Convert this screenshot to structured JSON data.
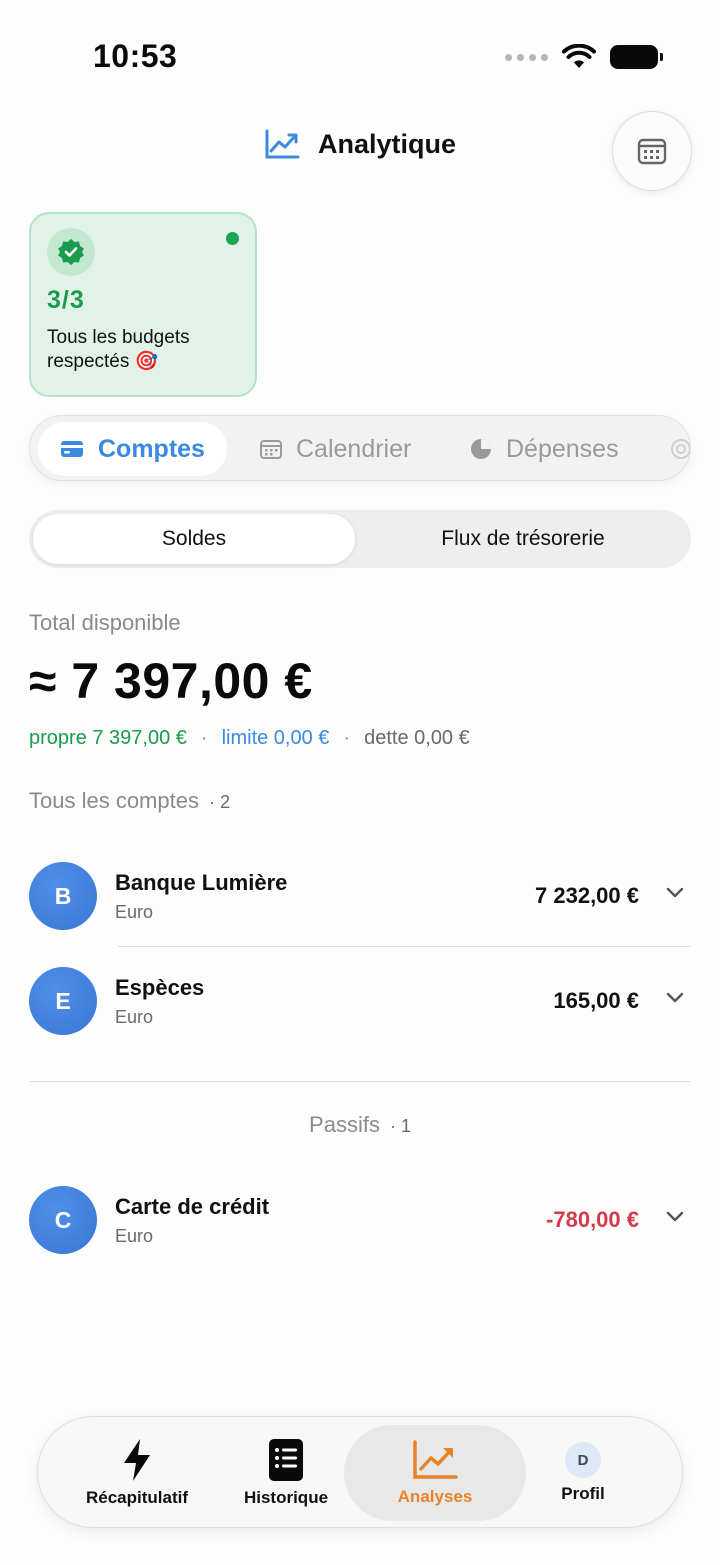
{
  "status_bar": {
    "time": "10:53"
  },
  "header": {
    "title": "Analytique"
  },
  "budget_card": {
    "count": "3/3",
    "text": "Tous les budgets respectés 🎯"
  },
  "tabs": [
    {
      "label": "Comptes",
      "active": true
    },
    {
      "label": "Calendrier",
      "active": false
    },
    {
      "label": "Dépenses",
      "active": false
    }
  ],
  "switch": {
    "option_on": "Soldes",
    "option_off": "Flux de trésorerie"
  },
  "summary": {
    "label": "Total disponible",
    "amount": "≈ 7 397,00 €",
    "own": "propre 7 397,00 €",
    "limit": "limite 0,00 €",
    "debt": "dette 0,00 €",
    "separator": "·"
  },
  "accounts_section": {
    "title": "Tous les comptes",
    "count": "· 2"
  },
  "accounts": [
    {
      "initial": "B",
      "name": "Banque Lumière",
      "currency": "Euro",
      "amount": "7 232,00 €"
    },
    {
      "initial": "E",
      "name": "Espèces",
      "currency": "Euro",
      "amount": "165,00 €"
    }
  ],
  "liabilities_section": {
    "title": "Passifs",
    "count": "· 1"
  },
  "liabilities": [
    {
      "initial": "C",
      "name": "Carte de crédit",
      "currency": "Euro",
      "amount": "-780,00 €"
    }
  ],
  "bottom_nav": [
    {
      "label": "Récapitulatif",
      "icon": "lightning-icon"
    },
    {
      "label": "Historique",
      "icon": "list-icon"
    },
    {
      "label": "Analyses",
      "icon": "chart-icon",
      "active": true
    },
    {
      "label": "Profil",
      "icon": "avatar",
      "avatar_initial": "D"
    }
  ],
  "colors": {
    "accent_blue": "#3b8ae0",
    "green": "#1a9b4e",
    "red": "#d63a4a",
    "orange": "#e8832a"
  }
}
